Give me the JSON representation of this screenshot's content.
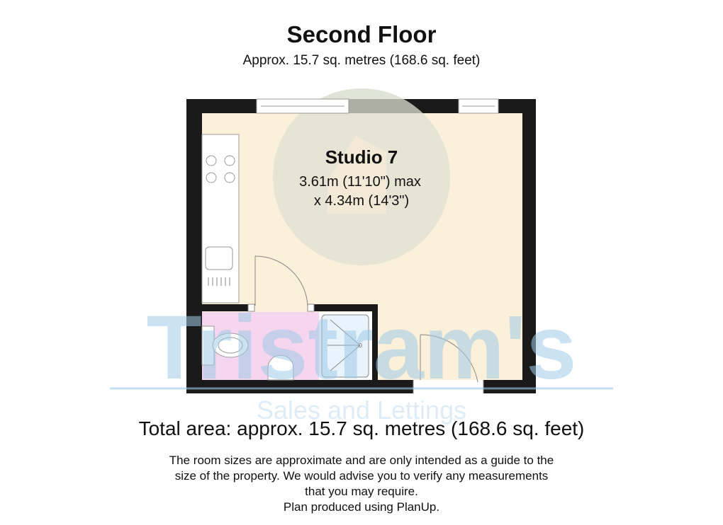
{
  "header": {
    "title": "Second Floor",
    "subtitle": "Approx. 15.7 sq. metres (168.6 sq. feet)"
  },
  "room": {
    "name": "Studio 7",
    "dim_line1": "3.61m (11'10\") max",
    "dim_line2": "x 4.34m (14'3\")"
  },
  "footer": {
    "total_area": "Total area: approx. 15.7 sq. metres (168.6 sq. feet)",
    "disclaimer": [
      "The room sizes are approximate and are only intended as a guide to the",
      "size of the property. We would advise you to verify any measurements",
      "that you may require.",
      "Plan produced using PlanUp."
    ]
  },
  "watermark": {
    "brand": "Tristram's",
    "tagline": "Sales and Lettings"
  },
  "colors": {
    "wall": "#1a1a1a",
    "floor": "#fbf0d9",
    "bathroom": "#f6d6ee",
    "watermark": "#9fcbe8"
  }
}
